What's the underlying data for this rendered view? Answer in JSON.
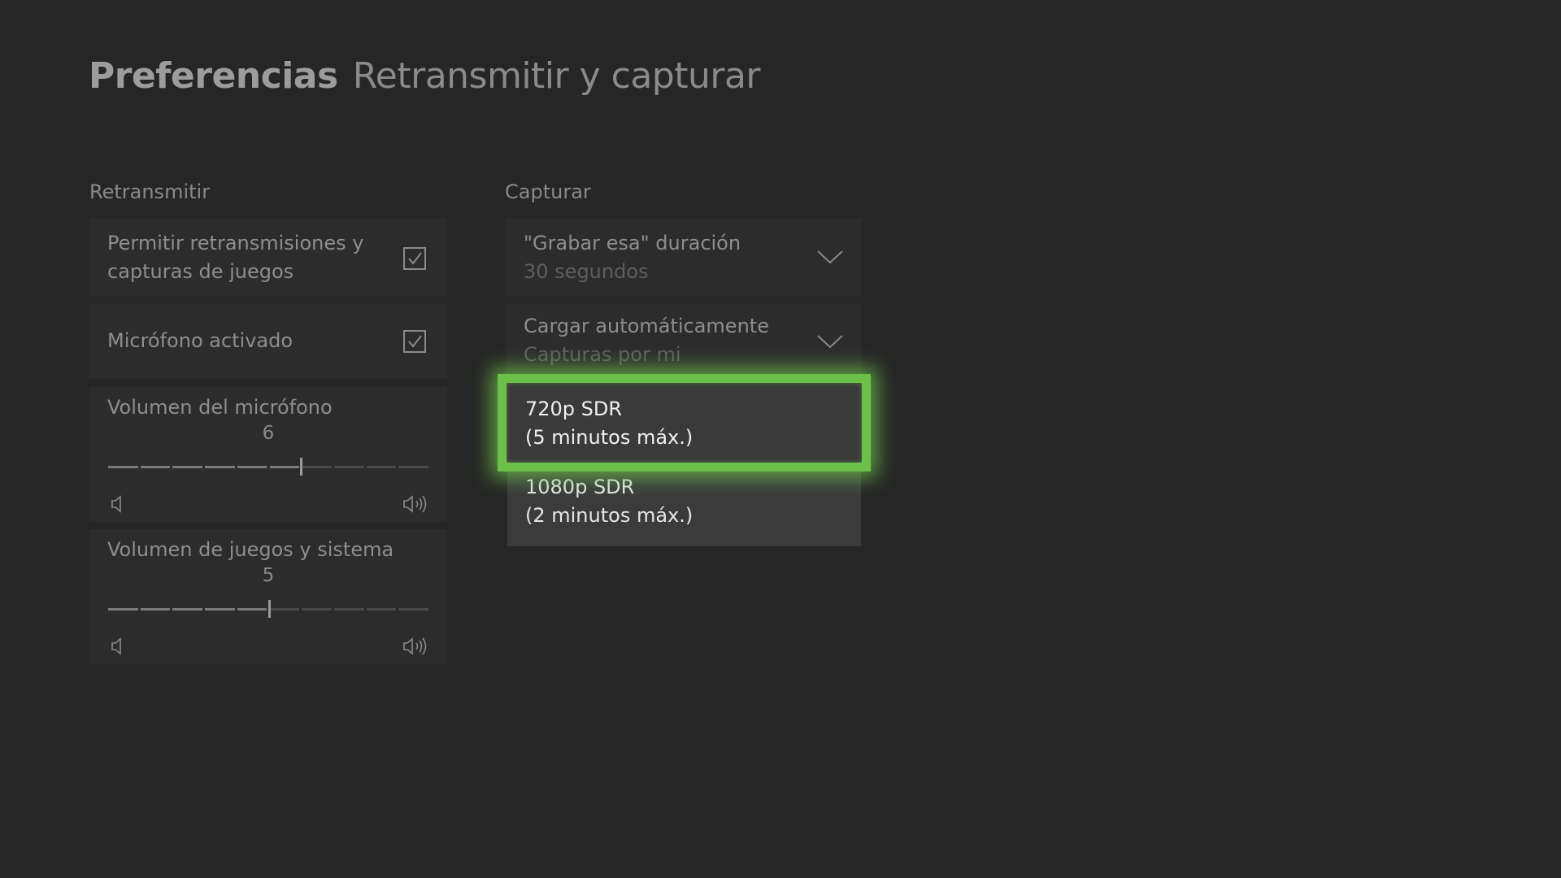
{
  "header": {
    "title": "Preferencias",
    "subtitle": "Retransmitir y capturar"
  },
  "broadcast": {
    "heading": "Retransmitir",
    "allow_broadcast": {
      "label_line1": "Permitir retransmisiones y",
      "label_line2": "capturas de juegos",
      "checked": true
    },
    "microphone": {
      "label": "Micrófono activado",
      "checked": true
    },
    "mic_volume": {
      "label": "Volumen del micrófono",
      "value": "6",
      "level": 6,
      "max": 10
    },
    "game_volume": {
      "label": "Volumen de juegos y sistema",
      "value": "5",
      "level": 5,
      "max": 10
    }
  },
  "capture": {
    "heading": "Capturar",
    "record_that": {
      "label": "\"Grabar esa\" duración",
      "value": "30 segundos"
    },
    "auto_upload": {
      "label": "Cargar automáticamente",
      "value": "Capturas por mi"
    },
    "resolution_options": [
      {
        "line1": "720p SDR",
        "line2": "(5 minutos máx.)",
        "focused": true
      },
      {
        "line1": "1080p SDR",
        "line2": "(2 minutos máx.)",
        "focused": false
      }
    ]
  },
  "colors": {
    "background": "#262626",
    "tile": "#2c2c2c",
    "focus_accent": "#6cc04a",
    "dropdown": "#3b3b3b"
  }
}
